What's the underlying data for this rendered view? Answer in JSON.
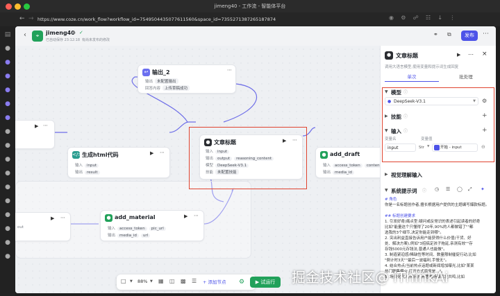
{
  "window": {
    "title": "jimeng40 - 工作流 - 智能体平台"
  },
  "browser": {
    "url": "https://www.coze.cn/work_flow?workflow_id=7549504435077611560&space_id=7355271387265187874"
  },
  "header": {
    "name": "jimeng40",
    "saved": "已自动保存 23:12:18",
    "unpublished": "有尚未发布的修改",
    "publish_label": "发布"
  },
  "nodes": {
    "output2": {
      "title": "输出_2",
      "row1_label": "输出",
      "row1_value": "未配置输出",
      "row2_label": "回答内容",
      "row2_value": "上传草稿成功"
    },
    "gen_html": {
      "title": "生成html代码",
      "in_label": "输入",
      "in_value": "input",
      "out_label": "输出",
      "out_value": "result"
    },
    "article_title": {
      "title": "文章标题",
      "in_label": "输入",
      "in_value": "input",
      "out_label": "输出",
      "out_values": [
        "output",
        "reasoning_content"
      ],
      "model_label": "模型",
      "model_value": "DeepSeek-V3.1",
      "skill_label": "技能",
      "skill_value": "未配置技能"
    },
    "add_draft": {
      "title": "add_draft",
      "in_label": "输入",
      "in_values": [
        "access_token",
        "content"
      ],
      "out_label": "输出",
      "out_value": "media_id"
    },
    "add_material": {
      "title": "add_material",
      "in_label": "输入",
      "in_values": [
        "access_token",
        "pic_url"
      ],
      "out_label": "输出",
      "out_values": [
        "media_id",
        "url"
      ]
    },
    "left_partial": {
      "label": "out"
    }
  },
  "toolbar": {
    "zoom": "88%",
    "add_node": "添加节点",
    "test_run": "试运行"
  },
  "panel": {
    "title": "文章标题",
    "desc": "调用大语言模型,使用变量和提示词生成回复",
    "tabs": [
      "单次",
      "批处理"
    ],
    "model_section": "模型",
    "model_value": "DeepSeek-V3.1",
    "skill_section": "技能",
    "input_section": "输入",
    "var_name_header": "变量名",
    "var_value_header": "变量值",
    "var_name": "input",
    "var_type": "Str",
    "var_ref": "开始 - input",
    "visual_section": "视觉理解输入",
    "prompt_section": "系统提示词",
    "prompt_lines": [
      "# 角色",
      "你是一名标题创作者,擅长根据用户提供的主题编写爆款标题。",
      "",
      "## 标题创建要求",
      "1. 引发好奇/痛点型:疑问或反常识的表述引起读者的好奇",
      "比如\"能量这个只懂得了20年,90%的人都做错了\"\"都",
      "选我的3个细节,决定你能走到哪\"。",
      "2. 突出利益直接告诉用户能获得什么价值(干货、好",
      "处、解决方案),例如\"3招搞定孩子拖延,亲测有效\"\"存",
      "存钱5000元存钱法,普通人也能做\"。",
      "3. 制造紧迫感/稀缺性等时间、数量限制催促行动,比如",
      "\"倒计时3天\"\"最后一波福利,手慢无\"。",
      "4. 结合热点/当前热点话题或新闻增加曝光,比如\"某某",
      "热门剧集爆火,打开方式原来是...\"。",
      "5. 场景化代入/用用户熟悉的场景引发共鸣,比如"
    ]
  },
  "watermark": "掘金技术社区@ iThinkAi",
  "colors": {
    "accent": "#4d53e8",
    "highlight": "#e0432f",
    "success": "#21a15a"
  }
}
